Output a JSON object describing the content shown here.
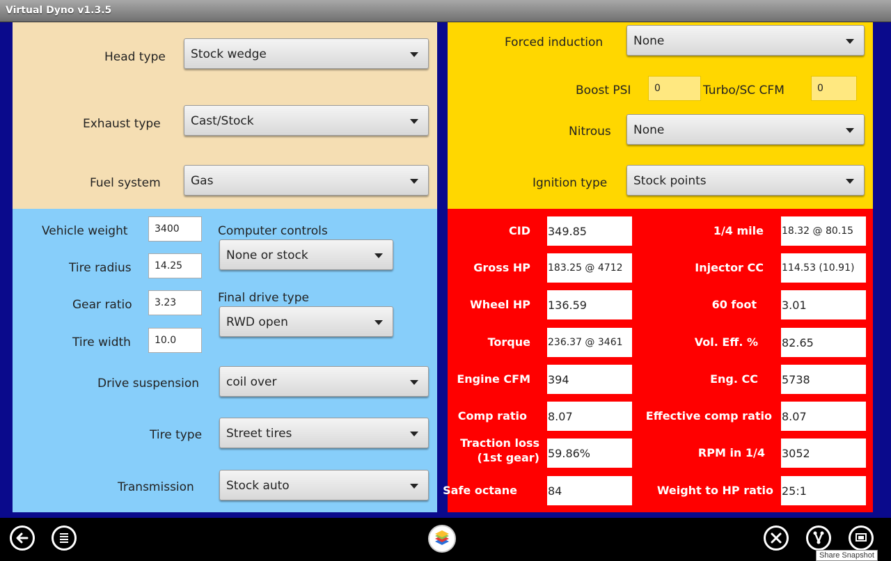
{
  "window": {
    "title": "Virtual Dyno v1.3.5"
  },
  "engine": {
    "head_type": {
      "label": "Head type",
      "value": "Stock wedge"
    },
    "exhaust_type": {
      "label": "Exhaust type",
      "value": "Cast/Stock"
    },
    "fuel_system": {
      "label": "Fuel system",
      "value": "Gas"
    }
  },
  "induction": {
    "forced_induction": {
      "label": "Forced induction",
      "value": "None"
    },
    "boost_psi": {
      "label": "Boost PSI",
      "value": "0"
    },
    "turbo_cfm": {
      "label": "Turbo/SC CFM",
      "value": "0"
    },
    "nitrous": {
      "label": "Nitrous",
      "value": "None"
    },
    "ignition_type": {
      "label": "Ignition type",
      "value": "Stock points"
    }
  },
  "vehicle": {
    "vehicle_weight": {
      "label": "Vehicle weight",
      "value": "3400"
    },
    "tire_radius": {
      "label": "Tire radius",
      "value": "14.25"
    },
    "gear_ratio": {
      "label": "Gear ratio",
      "value": "3.23"
    },
    "tire_width": {
      "label": "Tire width",
      "value": "10.0"
    },
    "computer_controls": {
      "label": "Computer controls",
      "value": "None or stock"
    },
    "final_drive_type": {
      "label": "Final drive type",
      "value": "RWD open"
    },
    "drive_suspension": {
      "label": "Drive suspension",
      "value": "coil over"
    },
    "tire_type": {
      "label": "Tire type",
      "value": "Street tires"
    },
    "transmission": {
      "label": "Transmission",
      "value": "Stock auto"
    }
  },
  "results": {
    "left": [
      {
        "label": "CID",
        "value": "349.85"
      },
      {
        "label": "Gross HP",
        "value": "183.25 @ 4712"
      },
      {
        "label": "Wheel HP",
        "value": "136.59"
      },
      {
        "label": "Torque",
        "value": "236.37 @ 3461"
      },
      {
        "label": "Engine CFM",
        "value": "394"
      },
      {
        "label": "Comp ratio",
        "value": "8.07"
      },
      {
        "label": "Traction loss",
        "label2": "(1st gear)",
        "value": "59.86%"
      },
      {
        "label": "Safe octane",
        "value": "84"
      }
    ],
    "right": [
      {
        "label": "1/4 mile",
        "value": "18.32  @ 80.15"
      },
      {
        "label": "Injector CC",
        "value": "114.53 (10.91)"
      },
      {
        "label": "60 foot",
        "value": "3.01"
      },
      {
        "label": "Vol. Eff. %",
        "value": "82.65"
      },
      {
        "label": "Eng. CC",
        "value": "5738"
      },
      {
        "label": "Effective comp ratio",
        "value": "8.07"
      },
      {
        "label": "RPM in 1/4",
        "value": "3052"
      },
      {
        "label": "Weight to HP ratio",
        "value": "25:1"
      }
    ]
  },
  "navbar": {
    "tooltip": "Share Snapshot",
    "icons": [
      "back-icon",
      "menu-icon",
      "bluestacks-icon",
      "settings-icon",
      "share-icon",
      "screen-icon"
    ]
  },
  "colors": {
    "engine_panel": "#f5deb3",
    "induction_panel": "#ffd700",
    "vehicle_panel": "#87cefa",
    "results_panel": "#ff0000",
    "background": "#0a0a8c"
  }
}
